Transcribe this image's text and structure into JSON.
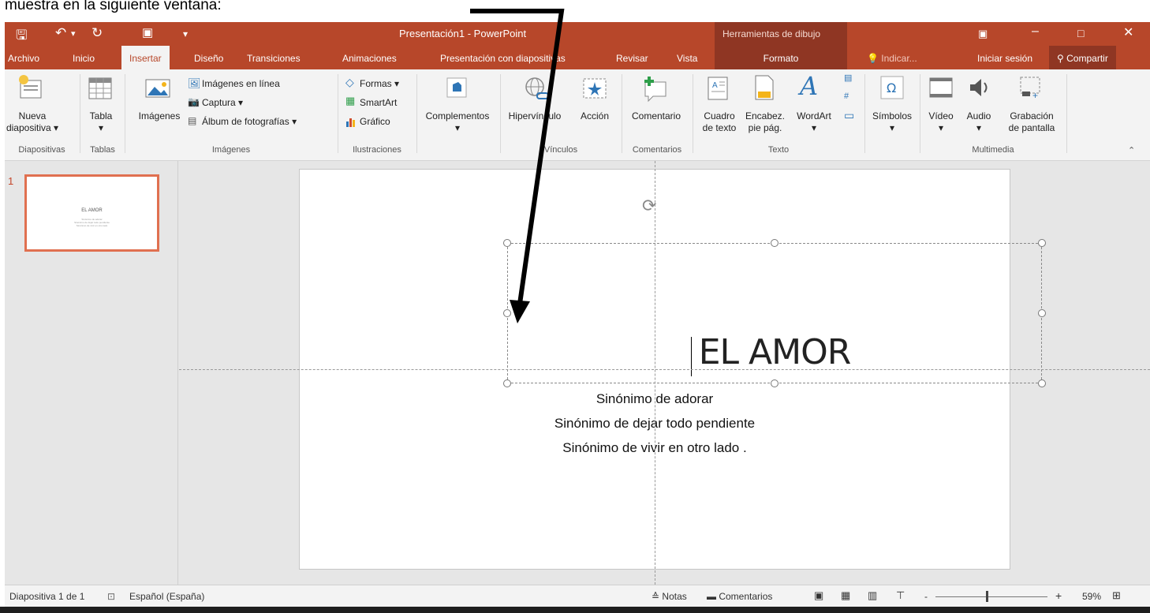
{
  "caption": "muestra en la siguiente ventana:",
  "titlebar": {
    "title": "Presentación1 - PowerPoint",
    "context_label": "Herramientas de dibujo"
  },
  "tabs": {
    "archivo": "Archivo",
    "inicio": "Inicio",
    "insertar": "Insertar",
    "diseno": "Diseño",
    "transiciones": "Transiciones",
    "animaciones": "Animaciones",
    "presentacion": "Presentación con diapositivas",
    "revisar": "Revisar",
    "vista": "Vista",
    "formato": "Formato",
    "indicar": "Indicar...",
    "iniciar_sesion": "Iniciar sesión",
    "compartir": "Compartir"
  },
  "ribbon": {
    "nueva_1": "Nueva",
    "nueva_2": "diapositiva ▾",
    "tabla_1": "Tabla",
    "tabla_2": "▾",
    "imagenes": "Imágenes",
    "imagenes_linea": "Imágenes en línea",
    "captura": "Captura ▾",
    "album": "Álbum de fotografías ▾",
    "formas": "Formas ▾",
    "smartart": "SmartArt",
    "grafico": "Gráfico",
    "complementos_1": "Complementos",
    "complementos_2": "▾",
    "hipervinculo": "Hipervínculo",
    "accion": "Acción",
    "comentario": "Comentario",
    "cuadro_1": "Cuadro",
    "cuadro_2": "de texto",
    "encabez_1": "Encabez.",
    "encabez_2": "pie pág.",
    "wordart_1": "WordArt",
    "wordart_2": "▾",
    "simbolos_1": "Símbolos",
    "simbolos_2": "▾",
    "video_1": "Vídeo",
    "video_2": "▾",
    "audio_1": "Audio",
    "audio_2": "▾",
    "grabacion_1": "Grabación",
    "grabacion_2": "de pantalla",
    "groups": {
      "diapositivas": "Diapositivas",
      "tablas": "Tablas",
      "imagenes": "Imágenes",
      "ilustraciones": "Ilustraciones",
      "vinculos": "Vínculos",
      "comentarios": "Comentarios",
      "texto": "Texto",
      "multimedia": "Multimedia"
    }
  },
  "thumbnail": {
    "number": "1",
    "title": "EL AMOR",
    "lines": "Sinónimo de adorar\nSinónimo de dejar todo pendiente\nSinónimo de vivir en otro lado"
  },
  "slide": {
    "title": "EL AMOR",
    "line1": "Sinónimo de adorar",
    "line2": "Sinónimo de dejar todo pendiente",
    "line3": "Sinónimo de  vivir en otro lado ."
  },
  "status": {
    "slide_count": "Diapositiva 1 de 1",
    "language": "Español (España)",
    "notas": "Notas",
    "comentarios": "Comentarios",
    "zoom": "59%",
    "zoom_minus": "-",
    "zoom_plus": "+"
  },
  "colors": {
    "accent": "#b7472a",
    "context": "#8f3623"
  }
}
